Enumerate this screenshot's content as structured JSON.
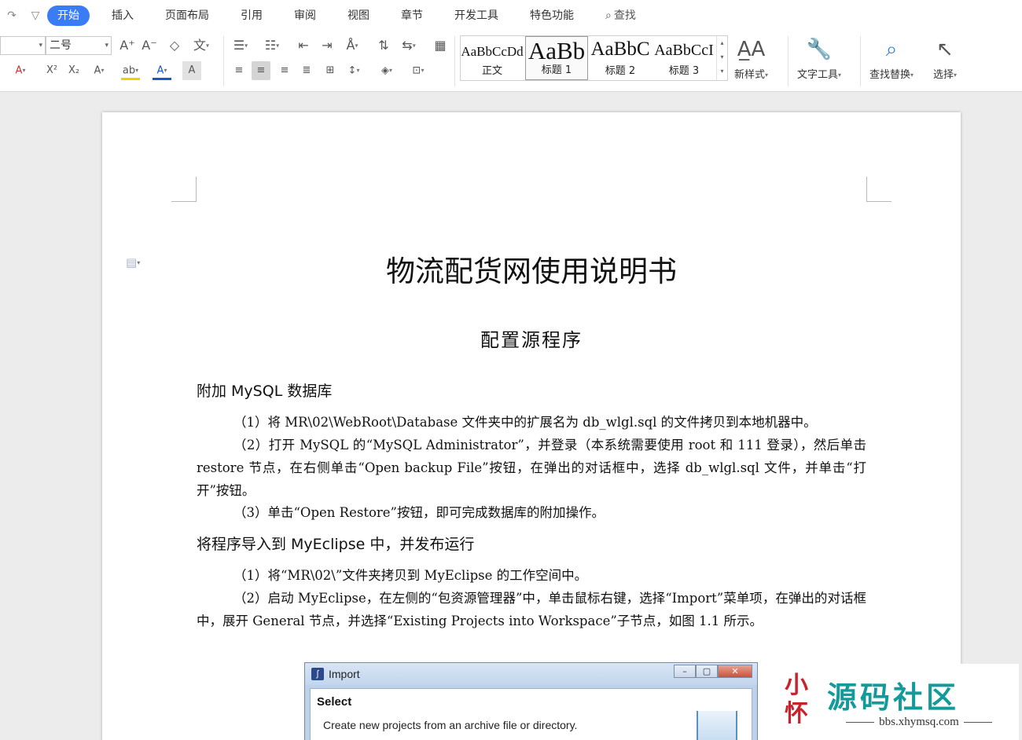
{
  "tabs": {
    "items": [
      "开始",
      "插入",
      "页面布局",
      "引用",
      "审阅",
      "视图",
      "章节",
      "开发工具",
      "特色功能"
    ],
    "search_label": "查找"
  },
  "ribbon": {
    "font_size": "二号",
    "styles": [
      {
        "sample": "AaBbCcDd",
        "name": "正文"
      },
      {
        "sample": "AaBb",
        "name": "标题 1"
      },
      {
        "sample": "AaBbC",
        "name": "标题 2"
      },
      {
        "sample": "AaBbCcI",
        "name": "标题 3"
      }
    ],
    "new_style": "新样式",
    "text_tools": "文字工具",
    "find_replace": "查找替换",
    "select": "选择"
  },
  "document": {
    "title": "物流配货网使用说明书",
    "subtitle": "配置源程序",
    "h1": "附加 MySQL 数据库",
    "p1": "（1）将 MR\\02\\WebRoot\\Database 文件夹中的扩展名为 db_wlgl.sql 的文件拷贝到本地机器中。",
    "p2": "（2）打开 MySQL 的“MySQL Administrator”，并登录（本系统需要使用 root 和 111 登录），然后单击 restore 节点，在右侧单击“Open backup File”按钮，在弹出的对话框中，选择 db_wlgl.sql 文件，并单击“打开”按钮。",
    "p3": "（3）单击“Open Restore”按钮，即可完成数据库的附加操作。",
    "h2": "将程序导入到 MyEclipse 中，并发布运行",
    "p4": "（1）将“MR\\02\\”文件夹拷贝到 MyEclipse 的工作空间中。",
    "p5": "（2）启动 MyEclipse，在左侧的“包资源管理器”中，单击鼠标右键，选择“Import”菜单项，在弹出的对话框中，展开 General 节点，并选择“Existing Projects into Workspace”子节点，如图 1.1 所示。"
  },
  "dialog": {
    "title": "Import",
    "heading": "Select",
    "description": "Create new projects from an archive file or directory."
  },
  "watermark": {
    "seal": "小",
    "seal2": "怀",
    "text": "源码社区",
    "url": "bbs.xhymsq.com"
  }
}
